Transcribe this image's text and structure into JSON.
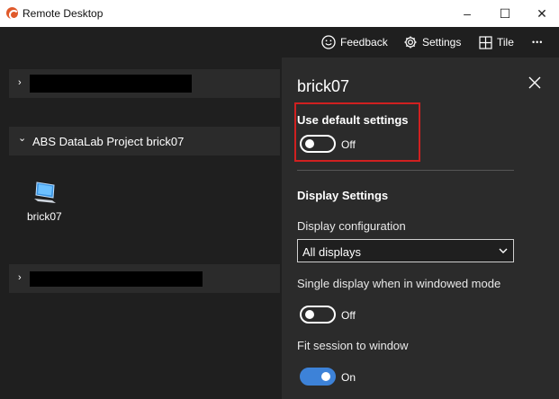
{
  "window": {
    "title": "Remote Desktop",
    "minimize_glyph": "–",
    "maximize_glyph": "☐",
    "close_glyph": "✕",
    "icon": "remote-desktop-app-icon"
  },
  "commandbar": {
    "feedback_label": "Feedback",
    "settings_label": "Settings",
    "tile_label": "Tile",
    "more_glyph": "•••"
  },
  "leftpane": {
    "groups": [
      {
        "label": "",
        "expanded": false,
        "redacted": true
      },
      {
        "label": "ABS DataLab Project brick07",
        "expanded": true,
        "redacted": false
      },
      {
        "label": "",
        "expanded": false,
        "redacted": true
      }
    ],
    "chevron_collapsed": "›",
    "chevron_expanded": "⌄",
    "pc": {
      "name": "brick07",
      "icon": "desktop-pc-icon"
    }
  },
  "settings_panel": {
    "title": "brick07",
    "use_default_label": "Use default settings",
    "use_default_state": "Off",
    "display_settings_heading": "Display Settings",
    "display_config_label": "Display configuration",
    "display_config_value": "All displays",
    "single_display_label": "Single display when in windowed mode",
    "single_display_state": "Off",
    "fit_session_label": "Fit session to window",
    "fit_session_state": "On"
  },
  "colors": {
    "background": "#1f1f1f",
    "panel": "#2b2b2b",
    "accent": "#3d82d8",
    "highlight_border": "#d02020"
  }
}
